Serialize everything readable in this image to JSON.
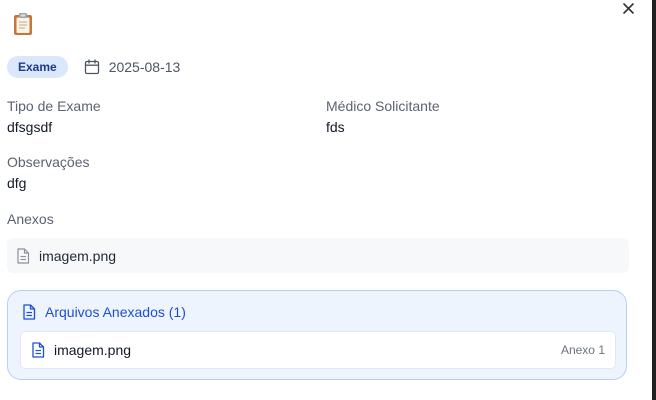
{
  "header": {
    "clipboard_icon": "clipboard-icon",
    "close_icon": "close-icon"
  },
  "meta": {
    "badge": "Exame",
    "calendar_icon": "calendar-icon",
    "date": "2025-08-13"
  },
  "fields": {
    "exam_type_label": "Tipo de Exame",
    "exam_type_value": "dfsgsdf",
    "doctor_label": "Médico Solicitante",
    "doctor_value": "fds",
    "notes_label": "Observações",
    "notes_value": "dfg"
  },
  "attachments": {
    "label": "Anexos",
    "items": [
      {
        "name": "imagem.png",
        "icon": "file-icon"
      }
    ]
  },
  "attached_files": {
    "title": "Arquivos Anexados (1)",
    "items": [
      {
        "name": "imagem.png",
        "tag": "Anexo 1",
        "icon": "file-icon"
      }
    ]
  },
  "colors": {
    "badge_bg": "#dbe7fb",
    "badge_text": "#1e3a8a",
    "panel_bg": "#eef4fd",
    "panel_border": "#b7cff3",
    "accent_blue": "#1d4ed8"
  }
}
